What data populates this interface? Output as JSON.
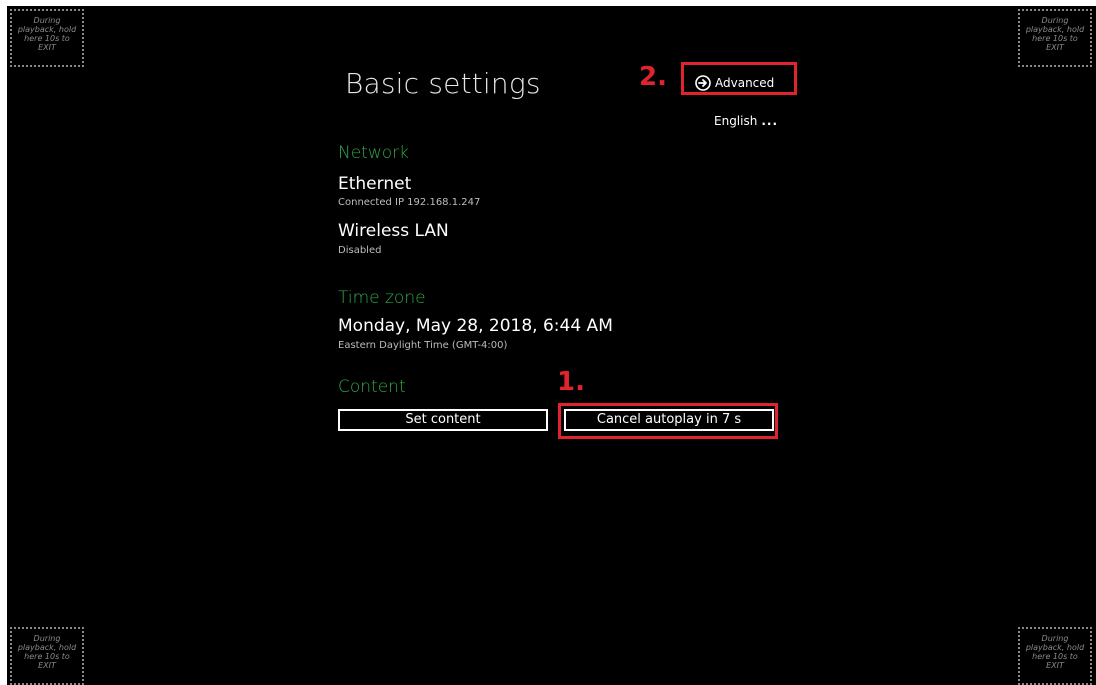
{
  "corner_hint": "During playback, hold here 10s to EXIT",
  "header": {
    "title": "Basic settings",
    "advanced_label": "Advanced",
    "language_label": "English",
    "language_more": "..."
  },
  "network": {
    "section_label": "Network",
    "ethernet": {
      "title": "Ethernet",
      "status": "Connected IP 192.168.1.247"
    },
    "wireless": {
      "title": "Wireless LAN",
      "status": "Disabled"
    }
  },
  "timezone": {
    "section_label": "Time zone",
    "datetime": "Monday, May 28, 2018, 6:44 AM",
    "zone": "Eastern Daylight Time (GMT-4:00)"
  },
  "content": {
    "section_label": "Content",
    "set_content_label": "Set content",
    "cancel_autoplay_label": "Cancel autoplay in 7 s"
  },
  "annotations": {
    "step1": "1.",
    "step2": "2.",
    "color": "#e0232d"
  },
  "colors": {
    "background": "#000000",
    "section_accent": "#2fa84a"
  }
}
